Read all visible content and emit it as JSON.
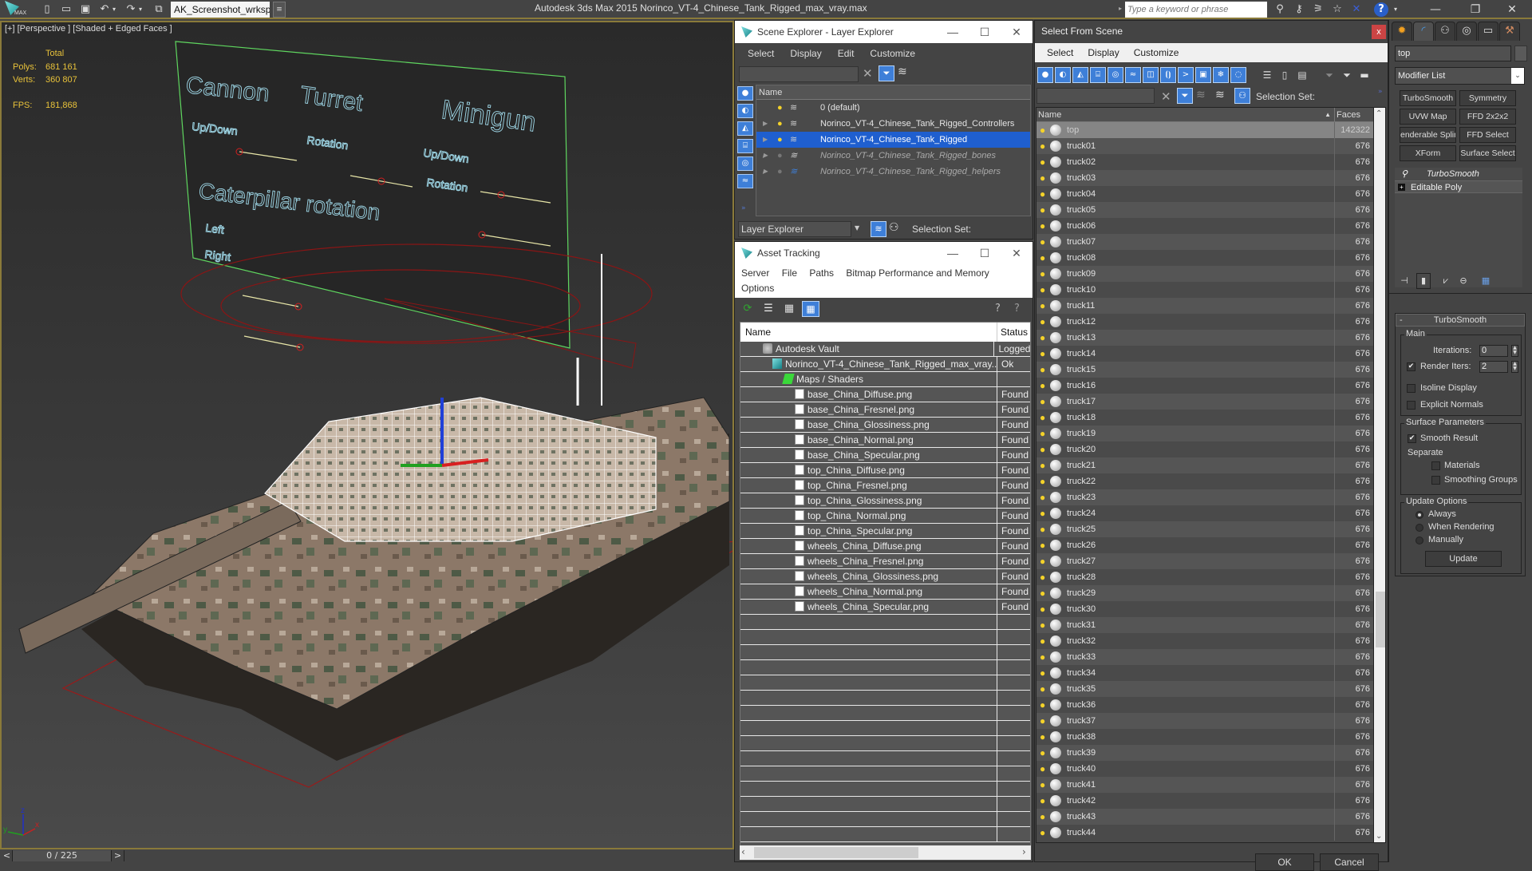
{
  "app": {
    "title": "Autodesk 3ds Max  2015    Norinco_VT-4_Chinese_Tank_Rigged_max_vray.max",
    "logo_text": "MAX",
    "workspace": "AK_Screenshot_wrksp",
    "search_placeholder": "Type a keyword or phrase",
    "quick_access": [
      "new-icon",
      "open-icon",
      "save-icon",
      "undo-icon",
      "redo-icon",
      "project-icon"
    ],
    "info_center_icons": [
      "binoculars-icon",
      "key-icon",
      "satellite-icon",
      "star-icon",
      "exchange-icon",
      "help-icon"
    ],
    "window_controls": [
      "minimize",
      "restore",
      "close"
    ]
  },
  "viewport": {
    "label": "[+] [Perspective ] [Shaded + Edged Faces ]",
    "stats": {
      "total_label": "Total",
      "polys_label": "Polys:",
      "polys": "681 161",
      "verts_label": "Verts:",
      "verts": "360 807",
      "fps_label": "FPS:",
      "fps": "181,868"
    },
    "controller_panel": {
      "cannon": "Cannon",
      "turret": "Turret",
      "minigun": "Minigun",
      "cannon_updown": "Up/Down",
      "turret_rotation": "Rotation",
      "minigun_updown": "Up/Down",
      "minigun_rotation": "Rotation",
      "caterpillar": "Caterpillar rotation",
      "left": "Left",
      "right": "Right"
    },
    "axis": {
      "x": "x",
      "y": "y",
      "z": "z"
    }
  },
  "timeline": {
    "prev": "<",
    "frame": "0 / 225",
    "next": ">"
  },
  "scene_explorer": {
    "title": "Scene Explorer - Layer Explorer",
    "menu": [
      "Select",
      "Display",
      "Edit",
      "Customize"
    ],
    "column": "Name",
    "layers": [
      {
        "name": "0 (default)",
        "state": "normal"
      },
      {
        "name": "Norinco_VT-4_Chinese_Tank_Rigged_Controllers",
        "state": "normal"
      },
      {
        "name": "Norinco_VT-4_Chinese_Tank_Rigged",
        "state": "selected"
      },
      {
        "name": "Norinco_VT-4_Chinese_Tank_Rigged_bones",
        "state": "hidden"
      },
      {
        "name": "Norinco_VT-4_Chinese_Tank_Rigged_helpers",
        "state": "hidden"
      }
    ],
    "footer_dropdown": "Layer Explorer",
    "selection_set_label": "Selection Set:"
  },
  "asset_tracking": {
    "title": "Asset Tracking",
    "menu": [
      "Server",
      "File",
      "Paths",
      "Bitmap Performance and Memory",
      "Options"
    ],
    "columns": [
      "Name",
      "Status"
    ],
    "rows": [
      {
        "name": "Autodesk Vault",
        "status": "Logged",
        "indent": 1,
        "icon": "vault"
      },
      {
        "name": "Norinco_VT-4_Chinese_Tank_Rigged_max_vray....",
        "status": "Ok",
        "indent": 2,
        "icon": "max"
      },
      {
        "name": "Maps / Shaders",
        "status": "",
        "indent": 3,
        "icon": "maps"
      },
      {
        "name": "base_China_Diffuse.png",
        "status": "Found",
        "indent": 4,
        "icon": "bitmap"
      },
      {
        "name": "base_China_Fresnel.png",
        "status": "Found",
        "indent": 4,
        "icon": "bitmap"
      },
      {
        "name": "base_China_Glossiness.png",
        "status": "Found",
        "indent": 4,
        "icon": "bitmap"
      },
      {
        "name": "base_China_Normal.png",
        "status": "Found",
        "indent": 4,
        "icon": "bitmap"
      },
      {
        "name": "base_China_Specular.png",
        "status": "Found",
        "indent": 4,
        "icon": "bitmap"
      },
      {
        "name": "top_China_Diffuse.png",
        "status": "Found",
        "indent": 4,
        "icon": "bitmap"
      },
      {
        "name": "top_China_Fresnel.png",
        "status": "Found",
        "indent": 4,
        "icon": "bitmap"
      },
      {
        "name": "top_China_Glossiness.png",
        "status": "Found",
        "indent": 4,
        "icon": "bitmap"
      },
      {
        "name": "top_China_Normal.png",
        "status": "Found",
        "indent": 4,
        "icon": "bitmap"
      },
      {
        "name": "top_China_Specular.png",
        "status": "Found",
        "indent": 4,
        "icon": "bitmap"
      },
      {
        "name": "wheels_China_Diffuse.png",
        "status": "Found",
        "indent": 4,
        "icon": "bitmap"
      },
      {
        "name": "wheels_China_Fresnel.png",
        "status": "Found",
        "indent": 4,
        "icon": "bitmap"
      },
      {
        "name": "wheels_China_Glossiness.png",
        "status": "Found",
        "indent": 4,
        "icon": "bitmap"
      },
      {
        "name": "wheels_China_Normal.png",
        "status": "Found",
        "indent": 4,
        "icon": "bitmap"
      },
      {
        "name": "wheels_China_Specular.png",
        "status": "Found",
        "indent": 4,
        "icon": "bitmap"
      }
    ],
    "empty_rows": 15
  },
  "select_from_scene": {
    "title": "Select From Scene",
    "close": "x",
    "menu": [
      "Select",
      "Display",
      "Customize"
    ],
    "selection_set_label": "Selection Set:",
    "columns": [
      "Name",
      "Faces"
    ],
    "sort_indicator": "▲",
    "objects": [
      {
        "name": "top",
        "faces": "142322",
        "selected": true
      },
      {
        "name": "truck01",
        "faces": "676"
      },
      {
        "name": "truck02",
        "faces": "676"
      },
      {
        "name": "truck03",
        "faces": "676"
      },
      {
        "name": "truck04",
        "faces": "676"
      },
      {
        "name": "truck05",
        "faces": "676"
      },
      {
        "name": "truck06",
        "faces": "676"
      },
      {
        "name": "truck07",
        "faces": "676"
      },
      {
        "name": "truck08",
        "faces": "676"
      },
      {
        "name": "truck09",
        "faces": "676"
      },
      {
        "name": "truck10",
        "faces": "676"
      },
      {
        "name": "truck11",
        "faces": "676"
      },
      {
        "name": "truck12",
        "faces": "676"
      },
      {
        "name": "truck13",
        "faces": "676"
      },
      {
        "name": "truck14",
        "faces": "676"
      },
      {
        "name": "truck15",
        "faces": "676"
      },
      {
        "name": "truck16",
        "faces": "676"
      },
      {
        "name": "truck17",
        "faces": "676"
      },
      {
        "name": "truck18",
        "faces": "676"
      },
      {
        "name": "truck19",
        "faces": "676"
      },
      {
        "name": "truck20",
        "faces": "676"
      },
      {
        "name": "truck21",
        "faces": "676"
      },
      {
        "name": "truck22",
        "faces": "676"
      },
      {
        "name": "truck23",
        "faces": "676"
      },
      {
        "name": "truck24",
        "faces": "676"
      },
      {
        "name": "truck25",
        "faces": "676"
      },
      {
        "name": "truck26",
        "faces": "676"
      },
      {
        "name": "truck27",
        "faces": "676"
      },
      {
        "name": "truck28",
        "faces": "676"
      },
      {
        "name": "truck29",
        "faces": "676"
      },
      {
        "name": "truck30",
        "faces": "676"
      },
      {
        "name": "truck31",
        "faces": "676"
      },
      {
        "name": "truck32",
        "faces": "676"
      },
      {
        "name": "truck33",
        "faces": "676"
      },
      {
        "name": "truck34",
        "faces": "676"
      },
      {
        "name": "truck35",
        "faces": "676"
      },
      {
        "name": "truck36",
        "faces": "676"
      },
      {
        "name": "truck37",
        "faces": "676"
      },
      {
        "name": "truck38",
        "faces": "676"
      },
      {
        "name": "truck39",
        "faces": "676"
      },
      {
        "name": "truck40",
        "faces": "676"
      },
      {
        "name": "truck41",
        "faces": "676"
      },
      {
        "name": "truck42",
        "faces": "676"
      },
      {
        "name": "truck43",
        "faces": "676"
      },
      {
        "name": "truck44",
        "faces": "676"
      }
    ],
    "scroll_position": 0.72,
    "ok": "OK",
    "cancel": "Cancel"
  },
  "command_panel": {
    "tabs": [
      "create",
      "modify",
      "hierarchy",
      "motion",
      "display",
      "utilities"
    ],
    "object_name": "top",
    "modifier_list": "Modifier List",
    "modifier_buttons": [
      "TurboSmooth",
      "Symmetry",
      "UVW Map",
      "FFD 2x2x2",
      "enderable Splin",
      "FFD Select",
      "XForm",
      "Surface Select"
    ],
    "stack": [
      {
        "name": "TurboSmooth",
        "italic": true
      },
      {
        "name": "Editable Poly",
        "italic": false
      }
    ],
    "turbosmooth": {
      "title": "TurboSmooth",
      "collapse": "-",
      "main_label": "Main",
      "iterations_label": "Iterations:",
      "iterations": "0",
      "render_iters_label": "Render Iters:",
      "render_iters": "2",
      "render_iters_checked": true,
      "isoline_label": "Isoline Display",
      "isoline_checked": false,
      "explicit_normals_label": "Explicit Normals",
      "explicit_normals_checked": false,
      "surface_label": "Surface Parameters",
      "smooth_result_label": "Smooth Result",
      "smooth_result_checked": true,
      "separate_label": "Separate",
      "materials_label": "Materials",
      "materials_checked": false,
      "smoothing_groups_label": "Smoothing Groups",
      "smoothing_groups_checked": false,
      "update_label": "Update Options",
      "always_label": "Always",
      "when_rendering_label": "When Rendering",
      "manually_label": "Manually",
      "update_mode": "always",
      "update_button": "Update"
    }
  },
  "colors": {
    "selection_blue": "#1f5fcf",
    "viewport_border": "#8a7a3a",
    "stats_yellow": "#e8c23a",
    "controller_text": "#9fd8e8",
    "controller_frame": "#5fd65f",
    "helper_red": "#9a1a1a"
  }
}
